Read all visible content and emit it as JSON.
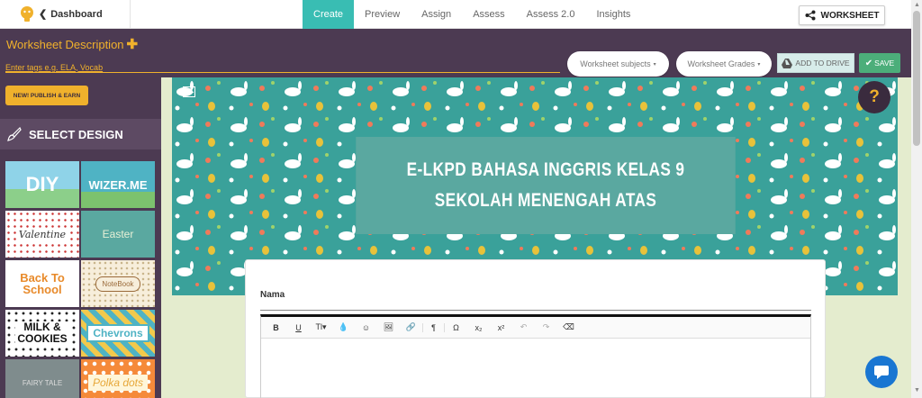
{
  "topbar": {
    "back_label": "Dashboard",
    "tabs": [
      {
        "label": "Create",
        "active": true
      },
      {
        "label": "Preview",
        "active": false
      },
      {
        "label": "Assign",
        "active": false
      },
      {
        "label": "Assess",
        "active": false
      },
      {
        "label": "Assess 2.0",
        "active": false
      },
      {
        "label": "Insights",
        "active": false
      }
    ],
    "share_label": "WORKSHEET",
    "accent": "#39bdb3"
  },
  "toolbar": {
    "desc_title": "Worksheet Description",
    "tags_placeholder": "Enter tags e.g. ELA, Vocab",
    "subjects_label": "Worksheet subjects",
    "grades_label": "Worksheet Grades",
    "drive_label": "ADD TO DRIVE",
    "save_label": "SAVE",
    "bg": "#4c3a52",
    "yellow": "#f0b12c"
  },
  "sidebar": {
    "publish_label": "NEW! PUBLISH & EARN",
    "select_design_label": "SELECT DESIGN",
    "designs": [
      "DIY",
      "WIZER.ME",
      "Valentine",
      "Easter",
      "Back To School",
      "NoteBook",
      "MILK & COOKIES",
      "Chevrons",
      "FAIRY TALE",
      "Polka dots"
    ]
  },
  "worksheet": {
    "title": "E-LKPD BAHASA INGGRIS KELAS 9 SEKOLAH MENENGAH ATAS",
    "field_label": "Nama",
    "editor_tools": [
      "B",
      "U",
      "Tl▾",
      "💧",
      "☺",
      "🖼",
      "🔗",
      "¶",
      "Ω",
      "x₂",
      "x²",
      "↶",
      "↷",
      "⌫"
    ]
  },
  "help": {
    "label": "?"
  }
}
